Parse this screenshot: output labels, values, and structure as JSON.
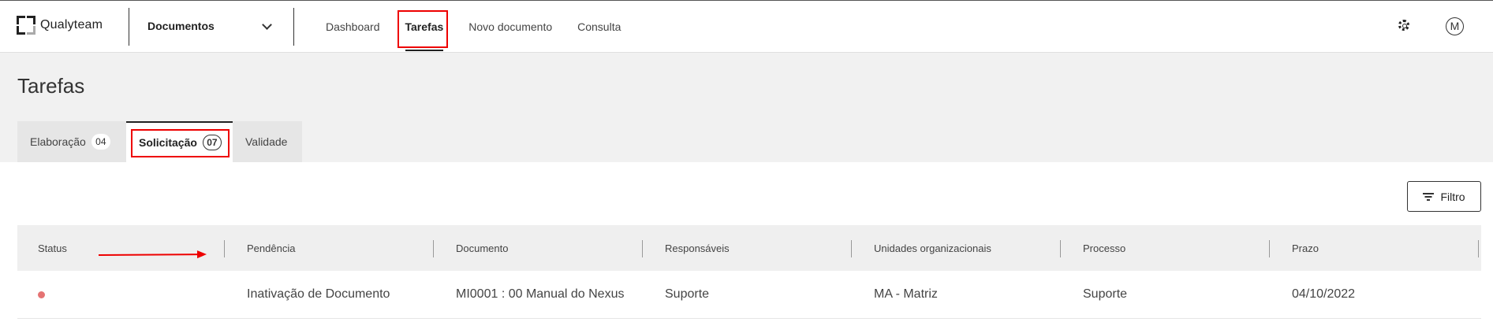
{
  "header": {
    "logo_text": "Qualyteam",
    "module_selector": "Documentos",
    "nav": [
      "Dashboard",
      "Tarefas",
      "Novo documento",
      "Consulta"
    ],
    "active_nav": "Tarefas",
    "avatar_initial": "M"
  },
  "page": {
    "title": "Tarefas",
    "tabs": [
      {
        "label": "Elaboração",
        "count": "04"
      },
      {
        "label": "Solicitação",
        "count": "07"
      },
      {
        "label": "Validade"
      }
    ],
    "active_tab": "Solicitação",
    "filter_label": "Filtro"
  },
  "table": {
    "columns": [
      "Status",
      "Pendência",
      "Documento",
      "Responsáveis",
      "Unidades organizacionais",
      "Processo",
      "Prazo"
    ],
    "rows": [
      {
        "status_color": "#e57373",
        "pendencia": "Inativação de Documento",
        "documento": "MI0001 : 00 Manual do Nexus",
        "responsaveis": "Suporte",
        "unidades": "MA - Matriz",
        "processo": "Suporte",
        "prazo": "04/10/2022"
      }
    ]
  },
  "annotations": {
    "highlight_color": "#e00000"
  }
}
